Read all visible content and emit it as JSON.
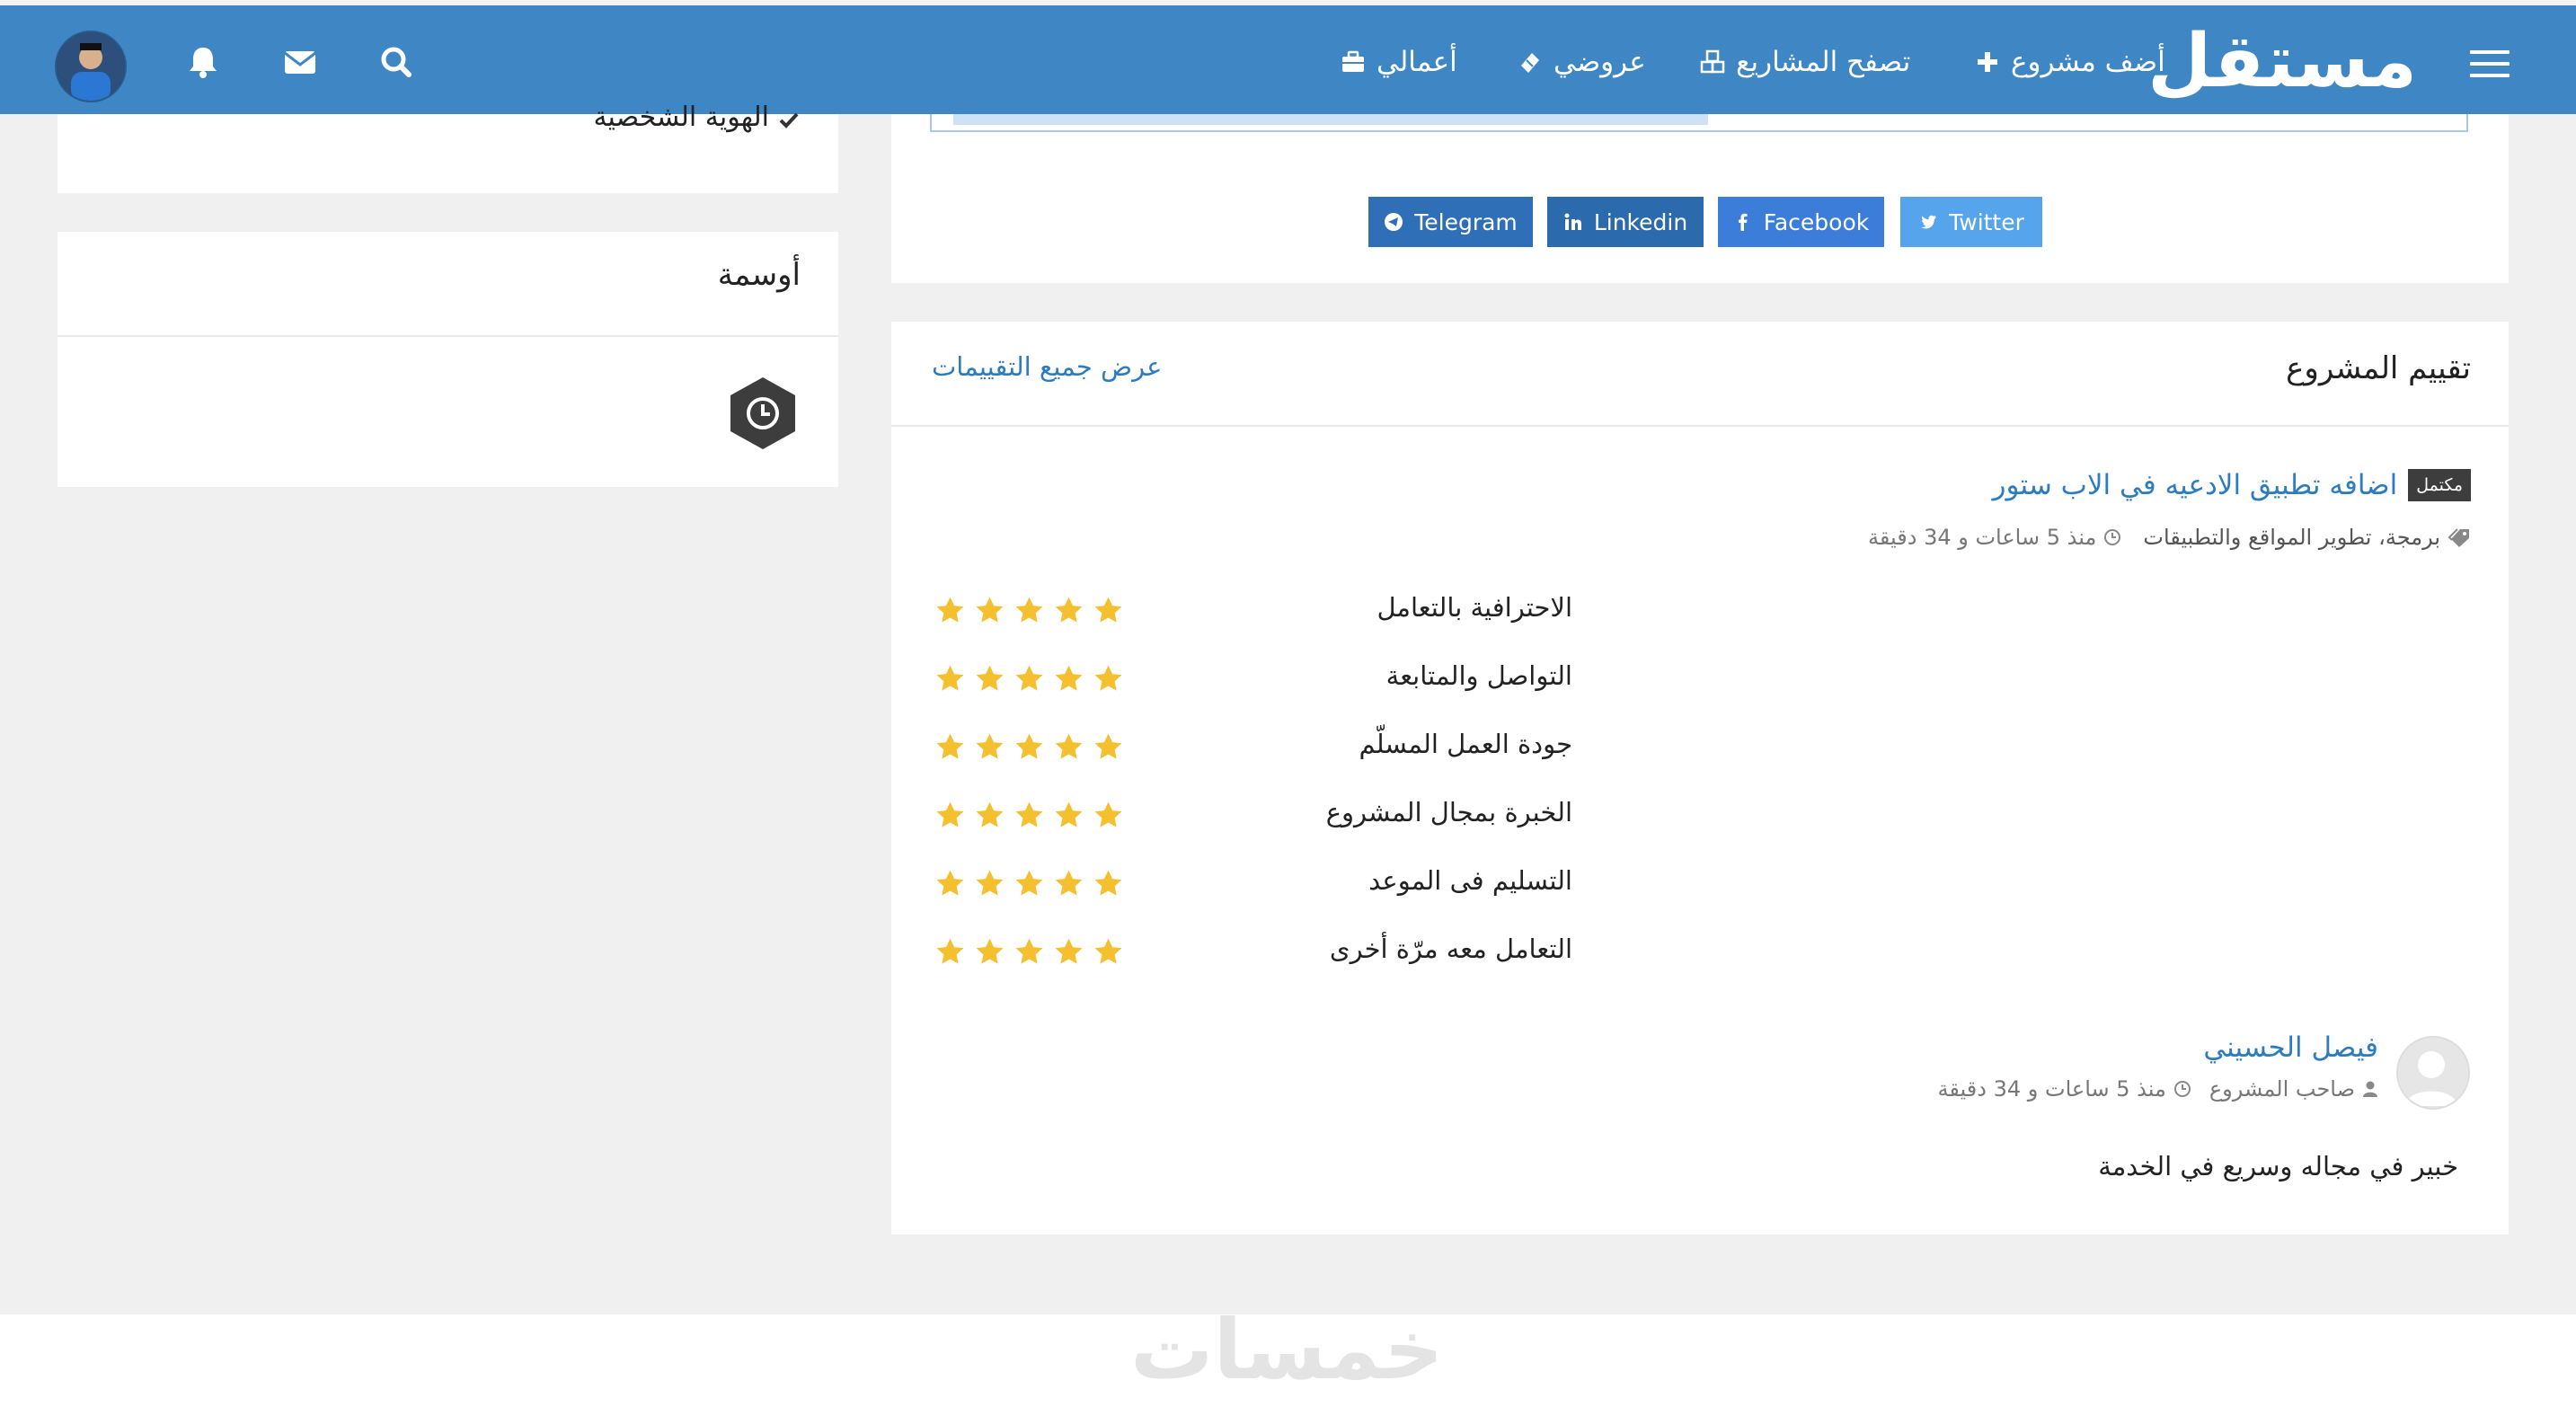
{
  "brand": {
    "logo_text": "مستقل",
    "accent": "#3f86c4",
    "link_color": "#2d7cc1",
    "star_color": "#f4c02f"
  },
  "nav": {
    "add_project": "أضف مشروع",
    "browse_projects": "تصفح المشاريع",
    "my_bids": "عروضي",
    "my_works": "أعمالي"
  },
  "sidebar": {
    "verified_item": "الهوية الشخصية",
    "badges_title": "أوسمة",
    "badge_icon": "clock-hexagon-icon"
  },
  "share": {
    "telegram": "Telegram",
    "linkedin": "Linkedin",
    "facebook": "Facebook",
    "twitter": "Twitter"
  },
  "review_section": {
    "title": "تقييم المشروع",
    "view_all": "عرض جميع التقييمات",
    "project": {
      "status_badge": "مكتمل",
      "title": "اضافه تطبيق الادعيه في الاب ستور",
      "categories": "برمجة، تطوير المواقع والتطبيقات",
      "time_ago": "منذ 5 ساعات و 34 دقيقة"
    },
    "criteria": [
      {
        "label": "الاحترافية بالتعامل",
        "rating": 5
      },
      {
        "label": "التواصل والمتابعة",
        "rating": 5
      },
      {
        "label": "جودة العمل المسلّم",
        "rating": 5
      },
      {
        "label": "الخبرة بمجال المشروع",
        "rating": 5
      },
      {
        "label": "التسليم فى الموعد",
        "rating": 5
      },
      {
        "label": "التعامل معه مرّة أخرى",
        "rating": 5
      }
    ],
    "reviewer": {
      "name": "فيصل الحسيني",
      "role": "صاحب المشروع",
      "time_ago": "منذ 5 ساعات و 34 دقيقة",
      "comment": "خبير في مجاله وسريع في الخدمة"
    }
  },
  "footer": {
    "watermark": "خمسات"
  }
}
